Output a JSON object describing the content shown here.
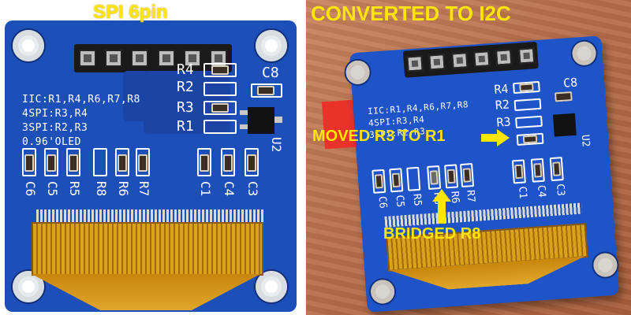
{
  "left_panel": {
    "title": "SPI 6pin",
    "silkscreen": [
      "IIC:R1,R4,R6,R7,R8",
      "4SPI:R3,R4",
      "3SPI:R2,R3",
      "0.96'OLED"
    ],
    "resistor_labels": [
      "R4",
      "R2",
      "R3",
      "R1"
    ],
    "component_labels": {
      "c8": "C8",
      "u2": "U2"
    },
    "bottom_labels": [
      "C6",
      "C5",
      "R5",
      "R8",
      "R6",
      "R7",
      "C1",
      "C4",
      "C3"
    ]
  },
  "right_panel": {
    "title": "CONVERTED TO I2C",
    "silkscreen": [
      "IIC:R1,R4,R6,R7,R8",
      "4SPI:R3,R4",
      "3SPI:R2,R3"
    ],
    "resistor_labels": [
      "R4",
      "R2",
      "R3"
    ],
    "component_labels": {
      "c8": "C8",
      "u2": "U2"
    },
    "bottom_labels": [
      "C6",
      "C5",
      "R5",
      "R8",
      "R6",
      "R7",
      "C1",
      "C4",
      "C3"
    ],
    "annotation_moved": "MOVED R3 TO R1",
    "annotation_bridged": "BRIDGED R8"
  },
  "colors": {
    "caption": "#ffe600",
    "pcb": "#1d4fb8",
    "ribbon": "#d9a21b",
    "desk": "#b8704c"
  }
}
